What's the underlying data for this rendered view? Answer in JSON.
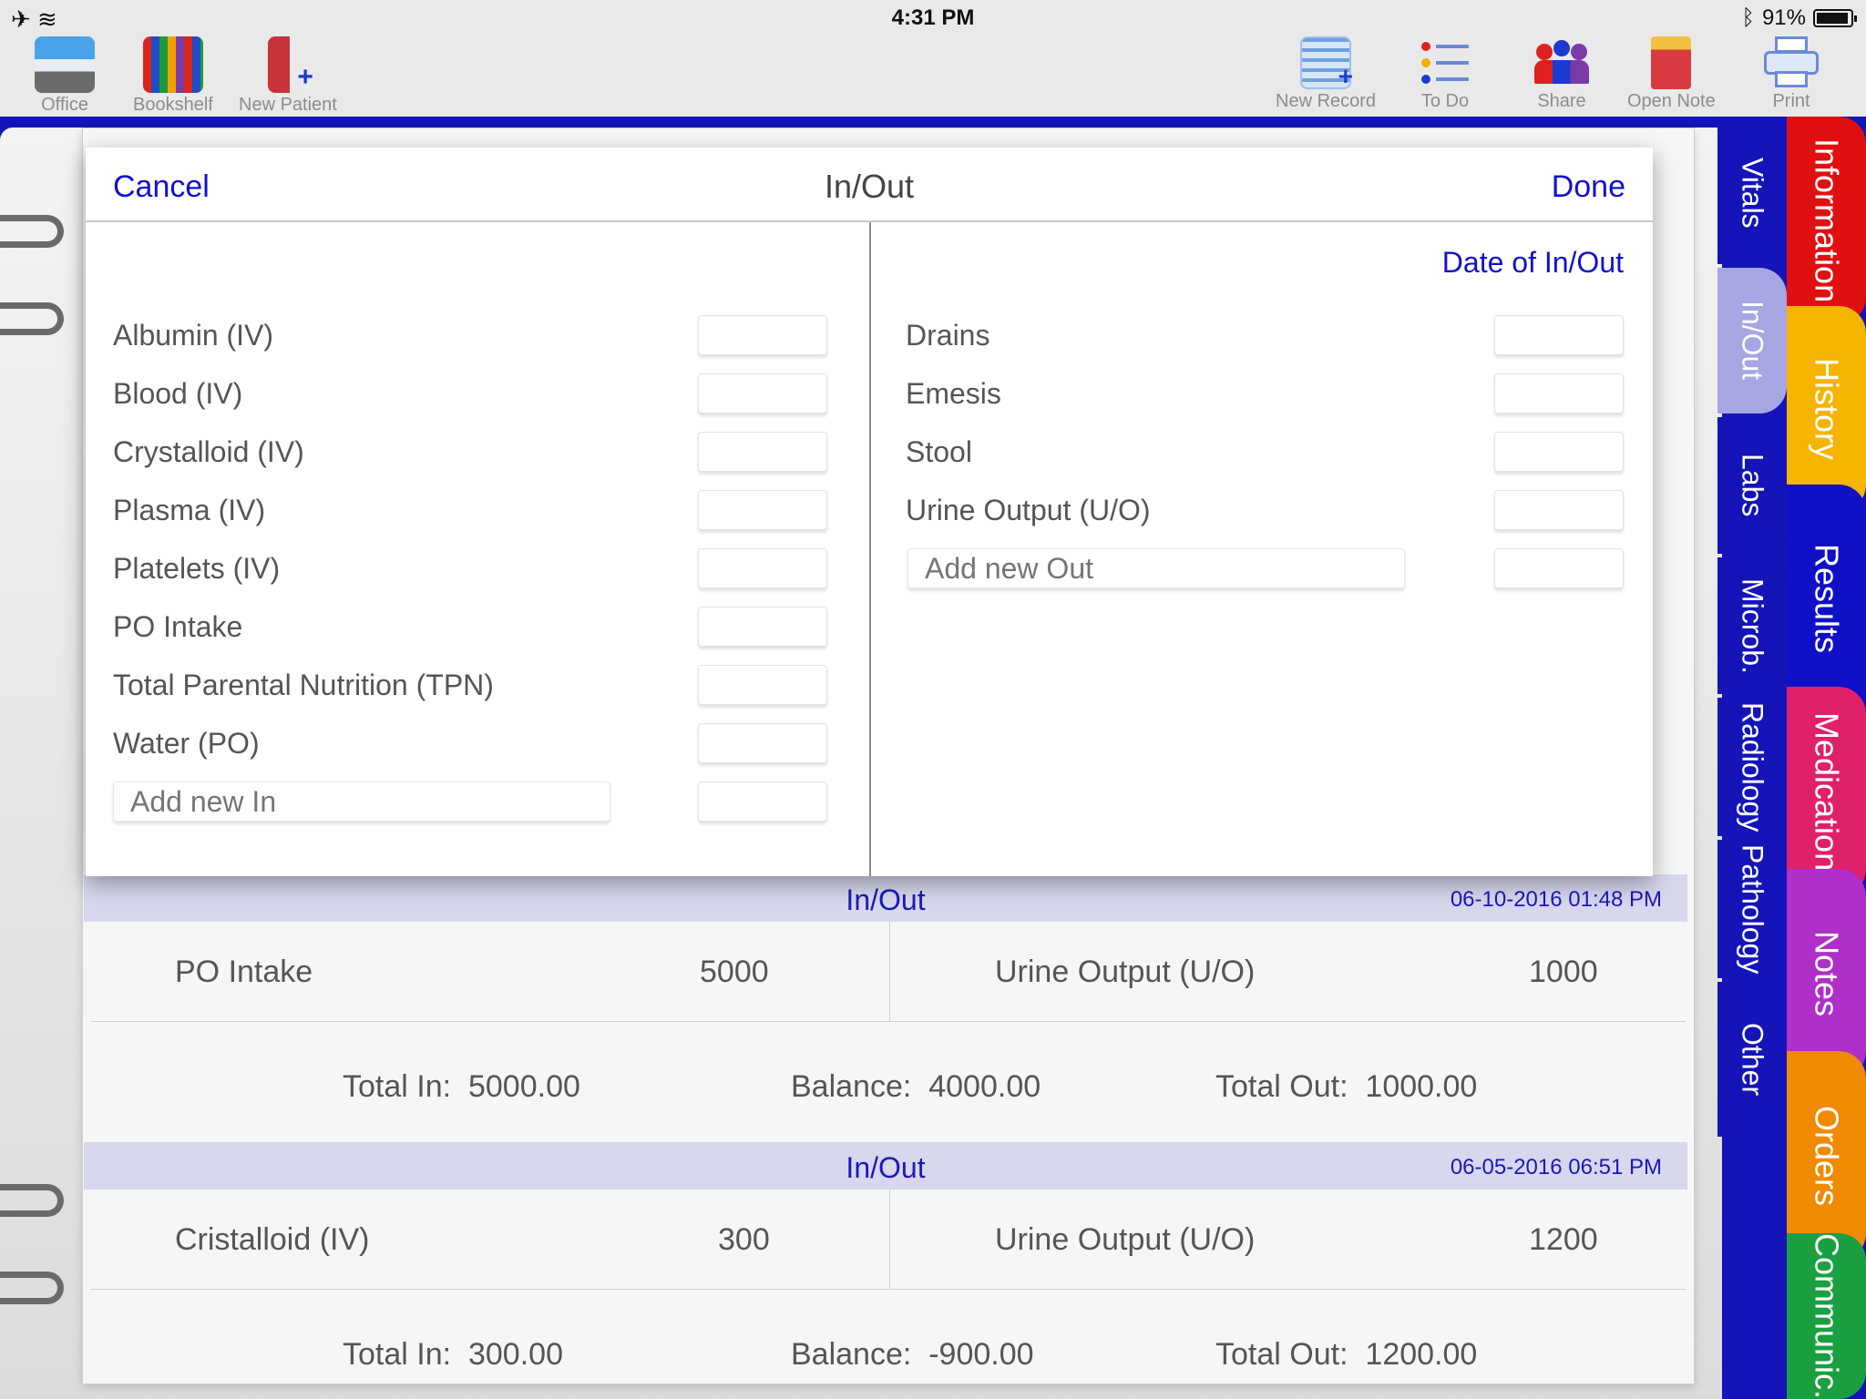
{
  "status_bar": {
    "time": "4:31 PM",
    "battery": "91%"
  },
  "toolbar": {
    "left": [
      {
        "label": "Office",
        "icon": "office-icon"
      },
      {
        "label": "Bookshelf",
        "icon": "bookshelf-icon"
      },
      {
        "label": "New Patient",
        "icon": "new-patient-icon"
      }
    ],
    "right": [
      {
        "label": "New Record",
        "icon": "new-record-icon"
      },
      {
        "label": "To Do",
        "icon": "todo-list-icon"
      },
      {
        "label": "Share",
        "icon": "share-people-icon"
      },
      {
        "label": "Open Note",
        "icon": "open-note-icon"
      },
      {
        "label": "Print",
        "icon": "printer-icon"
      }
    ]
  },
  "tabs": {
    "inner": [
      "Vitals",
      "In/Out",
      "Labs",
      "Microb.",
      "Radiology",
      "Pathology",
      "Other"
    ],
    "outer": [
      {
        "label": "Information",
        "color": "#e01010"
      },
      {
        "label": "History",
        "color": "#f5b400"
      },
      {
        "label": "Results",
        "color": "#1010c8"
      },
      {
        "label": "Medication",
        "color": "#e0206a"
      },
      {
        "label": "Notes",
        "color": "#b02fc8"
      },
      {
        "label": "Orders",
        "color": "#f08a00"
      },
      {
        "label": "Communic.",
        "color": "#1aa040"
      }
    ],
    "selected_inner": "In/Out"
  },
  "modal": {
    "cancel": "Cancel",
    "title": "In/Out",
    "done": "Done",
    "date_of": "Date of In/Out",
    "in_items": [
      "Albumin (IV)",
      "Blood (IV)",
      "Crystalloid (IV)",
      "Plasma (IV)",
      "Platelets (IV)",
      "PO Intake",
      "Total Parental Nutrition (TPN)",
      "Water (PO)"
    ],
    "in_placeholder": "Add new In",
    "out_items": [
      "Drains",
      "Emesis",
      "Stool",
      "Urine Output (U/O)"
    ],
    "out_placeholder": "Add new Out"
  },
  "records": [
    {
      "title": "In/Out",
      "date": "06-10-2016 01:48 PM",
      "in_name": "PO Intake",
      "in_value": "5000",
      "out_name": "Urine Output (U/O)",
      "out_value": "1000",
      "total_in_label": "Total In:",
      "total_in": "5000.00",
      "balance_label": "Balance:",
      "balance": "4000.00",
      "total_out_label": "Total Out:",
      "total_out": "1000.00"
    },
    {
      "title": "In/Out",
      "date": "06-05-2016 06:51 PM",
      "in_name": "Cristalloid (IV)",
      "in_value": "300",
      "out_name": "Urine Output (U/O)",
      "out_value": "1200",
      "total_in_label": "Total In:",
      "total_in": "300.00",
      "balance_label": "Balance:",
      "balance": "-900.00",
      "total_out_label": "Total Out:",
      "total_out": "1200.00"
    }
  ]
}
